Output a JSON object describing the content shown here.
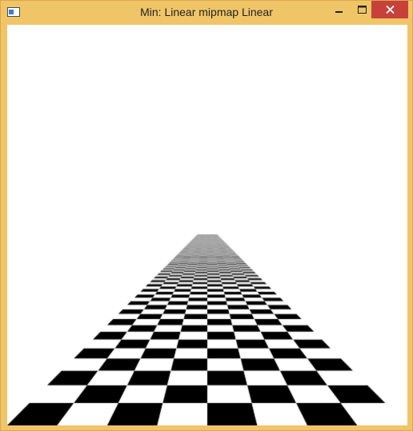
{
  "window": {
    "title": "Min: Linear mipmap Linear",
    "icon": "app-window-icon",
    "controls": {
      "minimize": "minimize-icon",
      "maximize": "maximize-icon",
      "close": "close-icon"
    },
    "colors": {
      "frame": "#f0c568",
      "close_button": "#c7413b"
    }
  },
  "scene": {
    "content": "checkerboard-plane",
    "colors": {
      "dark": "#000000",
      "light": "#ffffff",
      "background": "#ffffff"
    }
  }
}
